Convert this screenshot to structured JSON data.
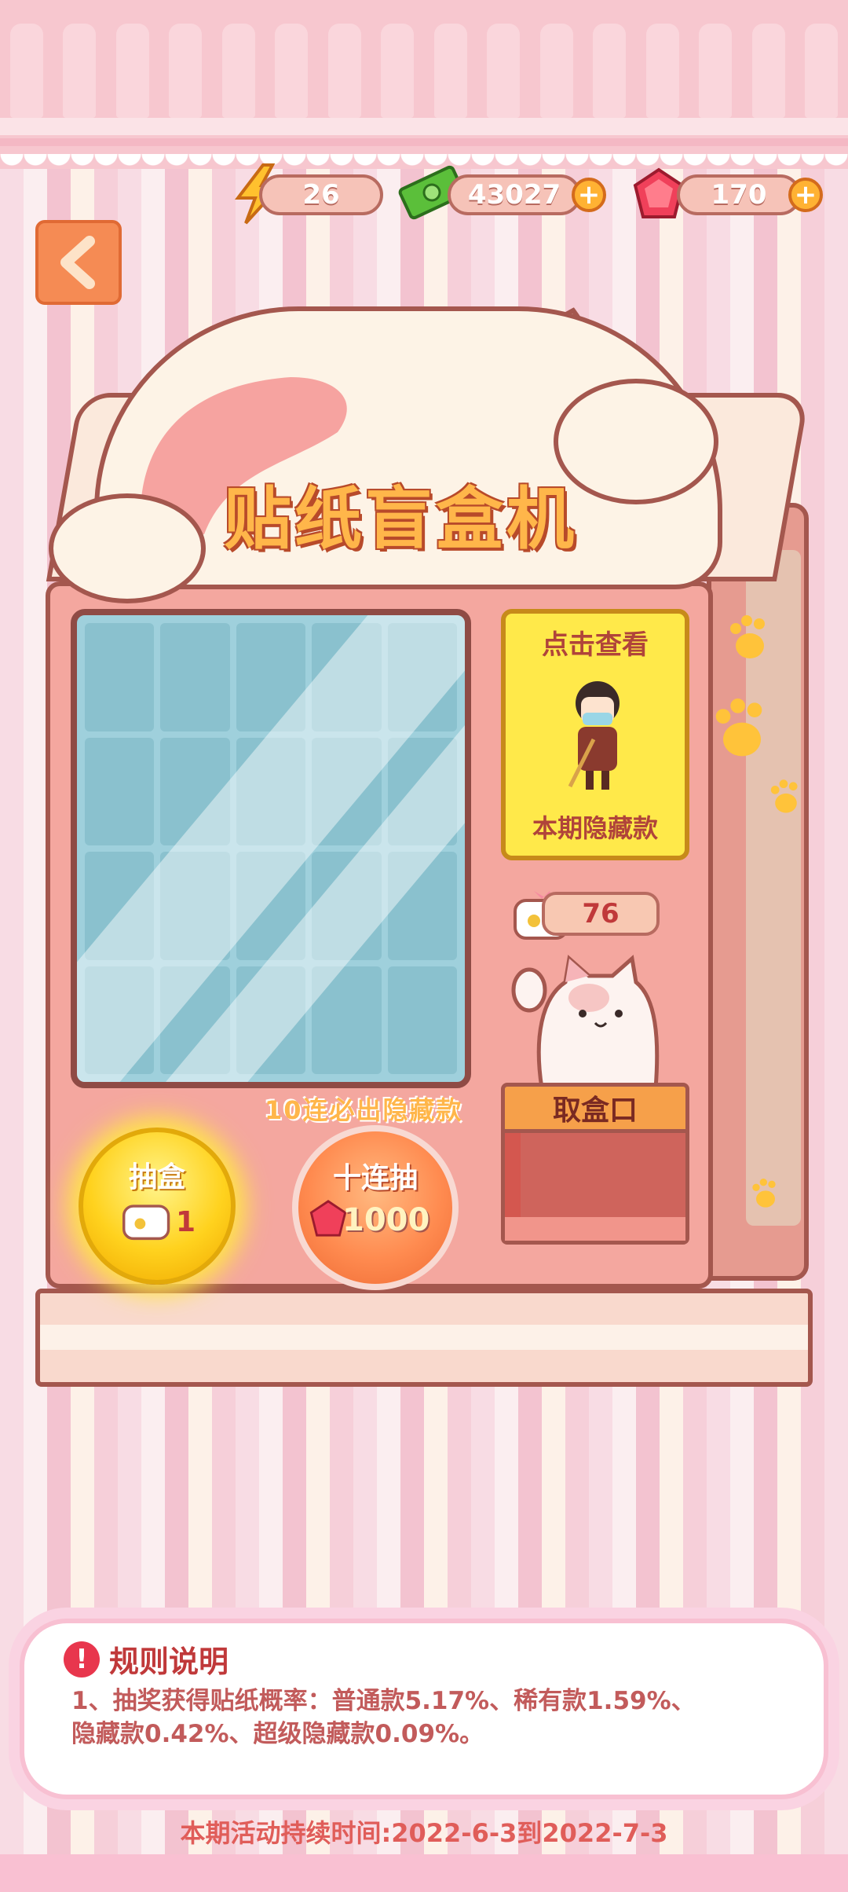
{
  "currencies": {
    "energy": {
      "value": "26",
      "icon": "lightning-icon"
    },
    "cash": {
      "value": "43027",
      "icon": "cash-icon",
      "add": "+"
    },
    "gems": {
      "value": "170",
      "icon": "gem-icon",
      "add": "+"
    }
  },
  "nav": {
    "back_icon": "chevron-left-icon"
  },
  "machine": {
    "title": "贴纸盲盒机",
    "hidden_card_top": "点击查看",
    "hidden_card_bottom": "本期隐藏款",
    "ticket_count": "76",
    "slot_label": "取盒口",
    "guarantee_text": "10连必出隐藏款"
  },
  "buttons": {
    "draw": {
      "label": "抽盒",
      "cost": "1"
    },
    "ten_draw": {
      "label": "十连抽",
      "cost": "1000"
    }
  },
  "rules": {
    "title": "规则说明",
    "text": "1、抽奖获得贴纸概率：普通款5.17%、稀有款1.59%、隐藏款0.42%、超级隐藏款0.09%。"
  },
  "duration": "本期活动持续时间:2022-6-3到2022-7-3",
  "colors": {
    "accent": "#ffb64a",
    "body": "#f4a79f",
    "outline": "#a4574e",
    "hidden_card": "#ffe94a"
  }
}
